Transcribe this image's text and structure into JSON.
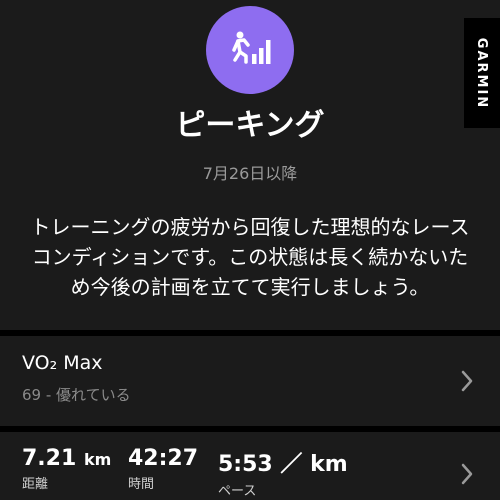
{
  "brand": "GARMIN",
  "status": {
    "icon": "runner-with-rising-bars-icon",
    "accent_color": "#8e6df0",
    "title": "ピーキング",
    "since": "7月26日以降",
    "description": "トレーニングの疲労から回復した理想的なレースコンディションです。この状態は長く続かないため今後の計画を立てて実行しましょう。"
  },
  "vo2": {
    "title": "VO₂ Max",
    "subtitle": "69 - 優れている"
  },
  "activity": {
    "distance_value": "7.21",
    "distance_unit": "km",
    "distance_label": "距離",
    "time_value": "42:27",
    "time_label": "時間",
    "pace_value": "5:53",
    "pace_unit": "／ km",
    "pace_label": "ペース"
  }
}
